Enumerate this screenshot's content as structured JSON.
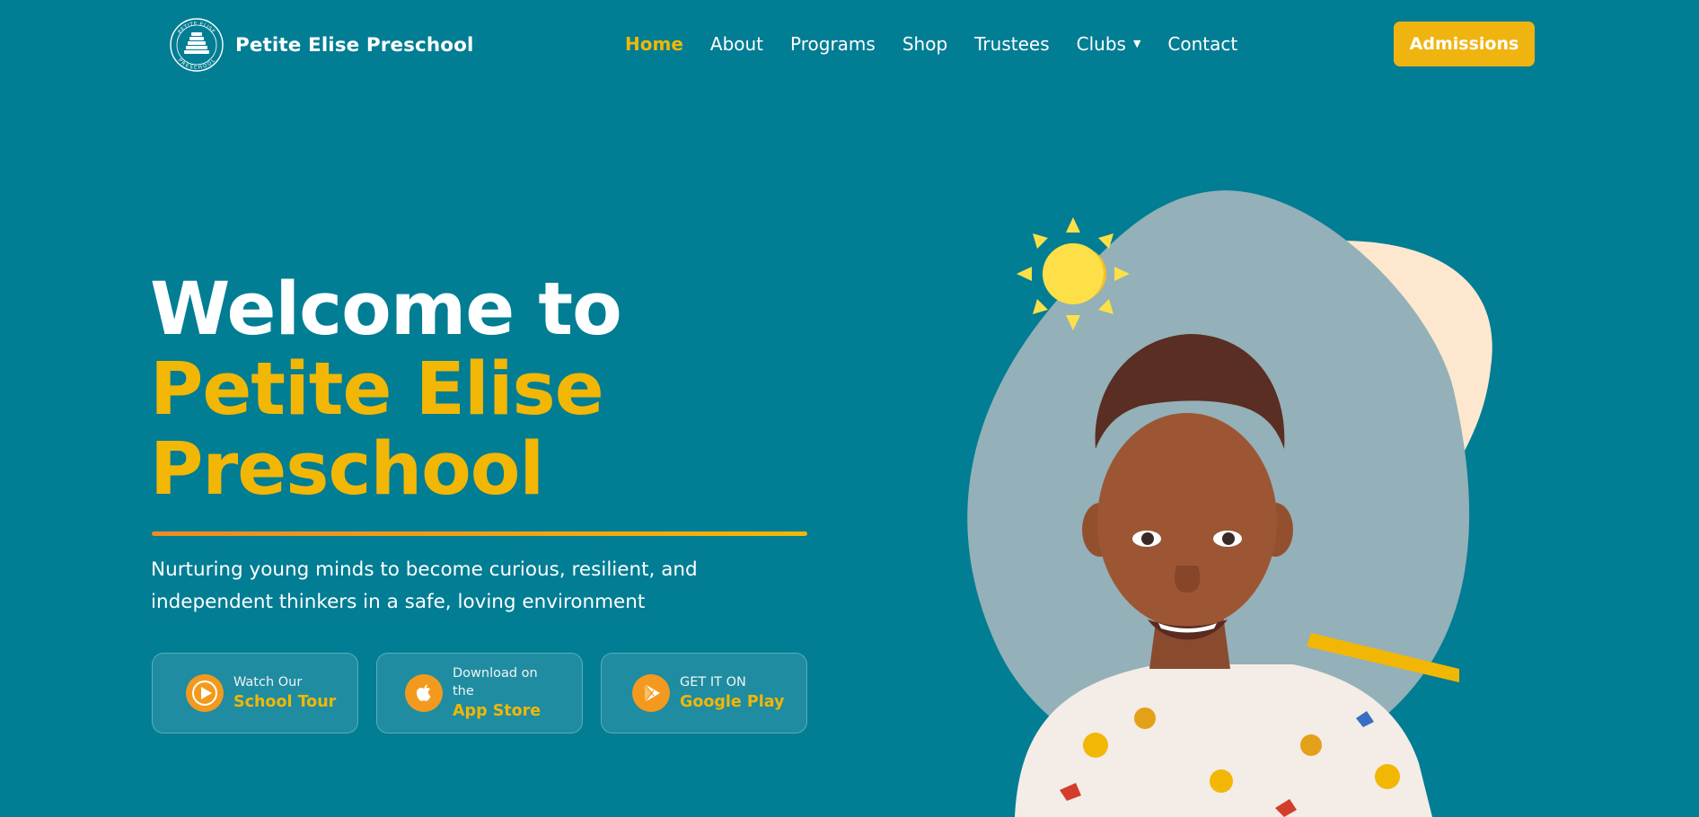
{
  "header": {
    "brand_name": "Petite Elise Preschool",
    "logo_text_top": "PETITE ELISE",
    "logo_text_bottom": "PRESCHOOL",
    "nav": [
      {
        "label": "Home",
        "active": true
      },
      {
        "label": "About"
      },
      {
        "label": "Programs"
      },
      {
        "label": "Shop"
      },
      {
        "label": "Trustees"
      },
      {
        "label": "Clubs",
        "has_dropdown": true
      },
      {
        "label": "Contact"
      }
    ],
    "admissions_label": "Admissions"
  },
  "hero": {
    "title_line1": "Welcome to",
    "title_line2": "Petite Elise",
    "title_line3": "Preschool",
    "tagline": "Nurturing young minds to become curious, resilient, and independent thinkers in a safe, loving environment",
    "ctas": [
      {
        "small": "Watch Our",
        "big": "School Tour",
        "icon": "play-icon"
      },
      {
        "small": "Download on the",
        "big": "App Store",
        "icon": "apple-icon"
      },
      {
        "small": "GET IT ON",
        "big": "Google Play",
        "icon": "google-play-icon"
      }
    ],
    "image_icons": [
      "sun-icon",
      "child-photo"
    ]
  },
  "colors": {
    "background": "#017d94",
    "accent": "#f2b705",
    "button": "#f0b410",
    "icon_orange": "#f39a1e",
    "blob": "#94b0b8",
    "blob_back": "#fde8cf"
  }
}
